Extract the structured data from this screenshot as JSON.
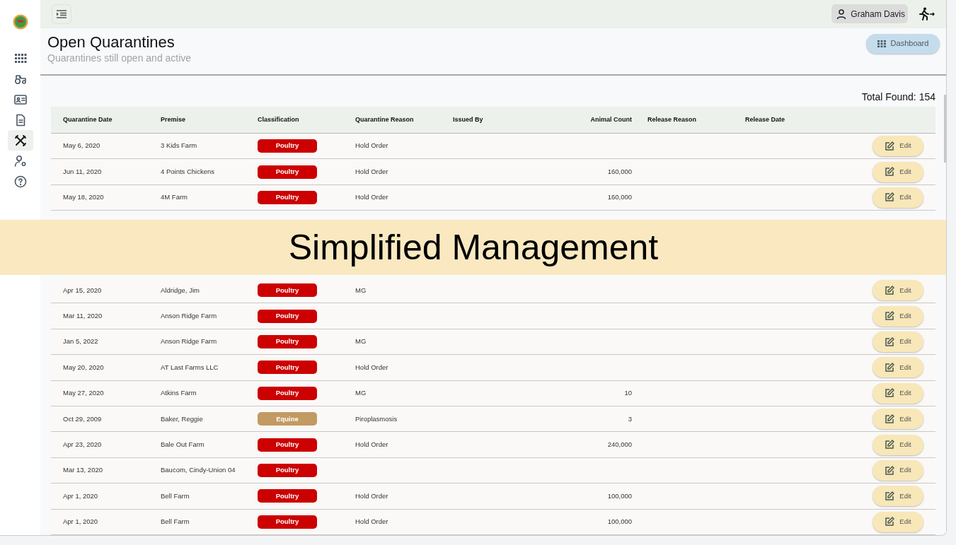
{
  "sidebar": {
    "items": [
      {
        "selected": false
      },
      {
        "selected": false
      },
      {
        "selected": false
      },
      {
        "selected": false
      },
      {
        "selected": true
      },
      {
        "selected": false
      },
      {
        "selected": false
      }
    ]
  },
  "topbar": {
    "user": "Graham Davis"
  },
  "header": {
    "title": "Open Quarantines",
    "subtitle": "Quarantines still open and active",
    "button": "Dashboard"
  },
  "total": "Total Found: 154",
  "table": {
    "columns": [
      "Quarantine Date",
      "Premise",
      "Classification",
      "Quarantine Reason",
      "Issued By",
      "Animal Count",
      "Release Reason",
      "Release Date"
    ],
    "rows": [
      {
        "date": "May 6, 2020",
        "premise": "3 Kids Farm",
        "classification": "Poultry",
        "color": "#cc0000",
        "reason": "Hold Order",
        "count": "",
        "action": "Edit"
      },
      {
        "date": "Jun 11, 2020",
        "premise": "4 Points Chickens",
        "classification": "Poultry",
        "color": "#cc0000",
        "reason": "Hold Order",
        "count": "160,000",
        "action": "Edit"
      },
      {
        "date": "May 18, 2020",
        "premise": "4M Farm",
        "classification": "Poultry",
        "color": "#cc0000",
        "reason": "Hold Order",
        "count": "160,000",
        "action": "Edit"
      },
      {
        "date": "Apr 15, 2020",
        "premise": "Aldridge, Jim",
        "classification": "Poultry",
        "color": "#cc0000",
        "reason": "MG",
        "count": "",
        "action": "Edit"
      },
      {
        "date": "Mar 11, 2020",
        "premise": "Anson Ridge Farm",
        "classification": "Poultry",
        "color": "#cc0000",
        "reason": "",
        "count": "",
        "action": "Edit"
      },
      {
        "date": "Jan 5, 2022",
        "premise": "Anson Ridge Farm",
        "classification": "Poultry",
        "color": "#cc0000",
        "reason": "MG",
        "count": "",
        "action": "Edit"
      },
      {
        "date": "May 20, 2020",
        "premise": "AT Last Farms LLC",
        "classification": "Poultry",
        "color": "#cc0000",
        "reason": "Hold Order",
        "count": "",
        "action": "Edit"
      },
      {
        "date": "May 27, 2020",
        "premise": "Atkins Farm",
        "classification": "Poultry",
        "color": "#cc0000",
        "reason": "MG",
        "count": "10",
        "action": "Edit"
      },
      {
        "date": "Oct 29, 2009",
        "premise": "Baker, Reggie",
        "classification": "Equine",
        "color": "#c29a62",
        "reason": "Piroplasmosis",
        "count": "3",
        "action": "Edit"
      },
      {
        "date": "Apr 23, 2020",
        "premise": "Bale Out Farm",
        "classification": "Poultry",
        "color": "#cc0000",
        "reason": "Hold Order",
        "count": "240,000",
        "action": "Edit"
      },
      {
        "date": "Mar 13, 2020",
        "premise": "Baucom, Cindy-Union 04",
        "classification": "Poultry",
        "color": "#cc0000",
        "reason": "",
        "count": "",
        "action": "Edit"
      },
      {
        "date": "Apr 1, 2020",
        "premise": "Bell Farm",
        "classification": "Poultry",
        "color": "#cc0000",
        "reason": "Hold Order",
        "count": "100,000",
        "action": "Edit"
      },
      {
        "date": "Apr 1, 2020",
        "premise": "Bell Farm",
        "classification": "Poultry",
        "color": "#cc0000",
        "reason": "Hold Order",
        "count": "100,000",
        "action": "Edit"
      }
    ]
  },
  "banner": {
    "text": "Simplified Management"
  }
}
